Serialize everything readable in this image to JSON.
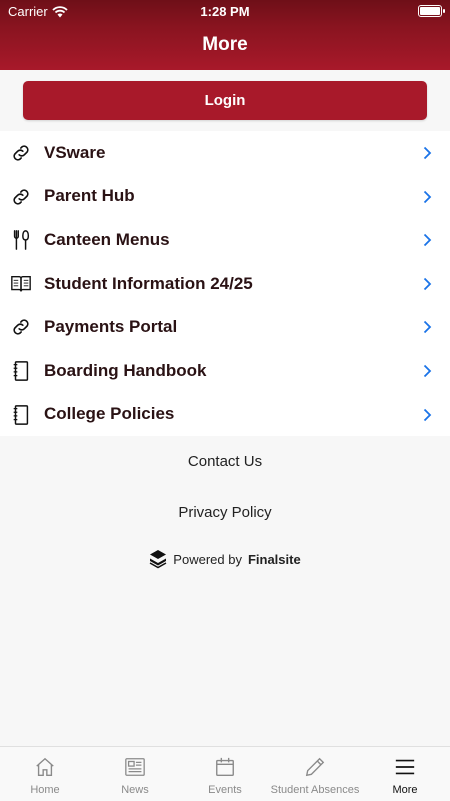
{
  "status_bar": {
    "carrier": "Carrier",
    "time": "1:28 PM"
  },
  "header": {
    "title": "More"
  },
  "login": {
    "label": "Login"
  },
  "menu": {
    "items": [
      {
        "label": "VSware",
        "icon": "link-icon"
      },
      {
        "label": "Parent Hub",
        "icon": "link-icon"
      },
      {
        "label": "Canteen Menus",
        "icon": "utensils-icon"
      },
      {
        "label": "Student Information 24/25",
        "icon": "open-book-icon"
      },
      {
        "label": "Payments Portal",
        "icon": "link-icon"
      },
      {
        "label": "Boarding Handbook",
        "icon": "notebook-icon"
      },
      {
        "label": "College Policies",
        "icon": "notebook-icon"
      }
    ]
  },
  "footer_links": {
    "contact": "Contact Us",
    "privacy": "Privacy Policy"
  },
  "powered_by": {
    "prefix": "Powered by",
    "brand": "Finalsite"
  },
  "tabbar": {
    "tabs": [
      {
        "label": "Home",
        "icon": "home-icon"
      },
      {
        "label": "News",
        "icon": "newspaper-icon"
      },
      {
        "label": "Events",
        "icon": "calendar-icon"
      },
      {
        "label": "Student Absences",
        "icon": "pencil-icon"
      },
      {
        "label": "More",
        "icon": "menu-icon",
        "active": true
      }
    ]
  },
  "colors": {
    "brand": "#a8192a",
    "header_dark": "#6e0f18",
    "chevron": "#1a73e8",
    "text": "#2a1214"
  }
}
